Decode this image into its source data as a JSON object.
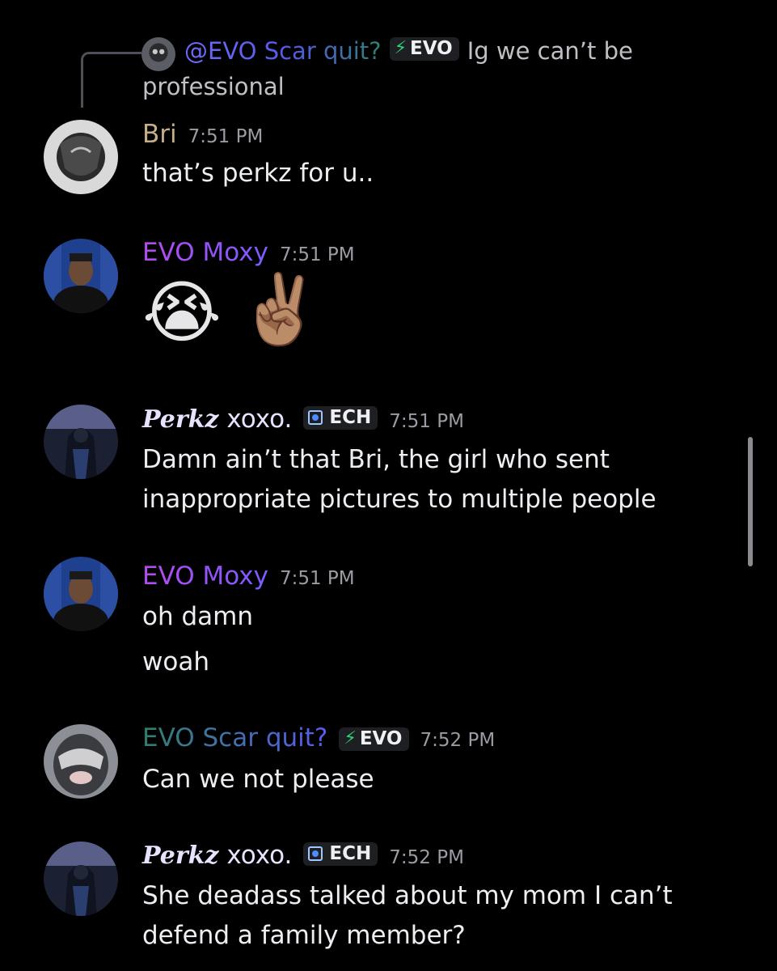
{
  "reply": {
    "mention": "@EVO Scar quit?",
    "badge": "EVO",
    "text_line1": "Ig we can’t be",
    "text_line2": "professional"
  },
  "messages": [
    {
      "author_a": "Bri",
      "time": "7:51 PM",
      "lines": [
        "that’s perkz for u.."
      ]
    },
    {
      "author_a": "EVO Moxy",
      "time": "7:51 PM",
      "emojis": [
        "😭",
        "✌🏽"
      ]
    },
    {
      "author_script": "Perkz",
      "author_rest": "xoxo.",
      "badge": "ECH",
      "time": "7:51 PM",
      "lines": [
        "Damn ain’t that Bri, the girl who sent",
        "inappropriate pictures to multiple people"
      ]
    },
    {
      "author_a": "EVO Moxy",
      "time": "7:51 PM",
      "lines": [
        "oh damn",
        "woah"
      ]
    },
    {
      "author_a": "EVO Scar quit?",
      "badge": "EVO",
      "time": "7:52 PM",
      "lines": [
        "Can we not please"
      ]
    },
    {
      "author_script": "Perkz",
      "author_rest": "xoxo.",
      "badge": "ECH",
      "time": "7:52 PM",
      "lines": [
        "She deadass talked about my mom I can’t",
        "defend a family member?"
      ]
    }
  ],
  "colors": {
    "bri": "#c7ae8a",
    "moxy_gradient": [
      "#b34bf0",
      "#7b5cff"
    ],
    "scar_gradient": [
      "#2f7f6e",
      "#5a5cf0"
    ],
    "perkz": "#c9c3f7",
    "bolt": "#2fd27a"
  },
  "icons": {
    "reply_avatar": "avatar-scar",
    "badge_evo": "lightning-bolt-icon",
    "badge_ech": "ech-flag-icon"
  }
}
